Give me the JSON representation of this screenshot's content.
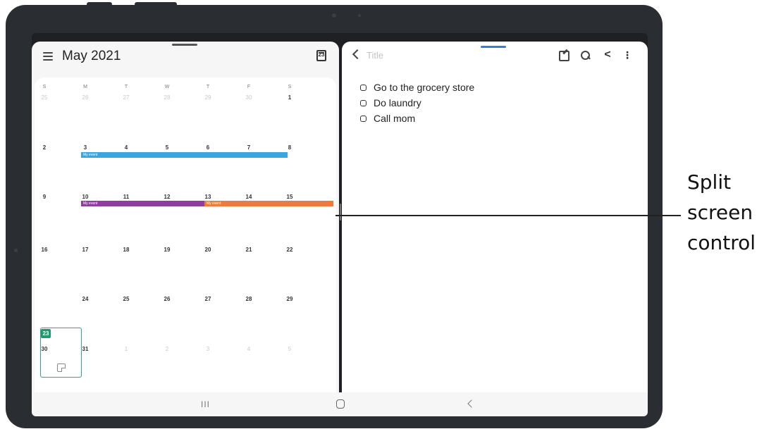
{
  "calendar": {
    "month_title": "May 2021",
    "today_icon_label": "23",
    "weekdays": [
      "S",
      "M",
      "T",
      "W",
      "T",
      "F",
      "S"
    ],
    "weeks": [
      [
        "25",
        "26",
        "27",
        "28",
        "29",
        "30",
        "1"
      ],
      [
        "2",
        "3",
        "4",
        "5",
        "6",
        "7",
        "8"
      ],
      [
        "9",
        "10",
        "11",
        "12",
        "13",
        "14",
        "15"
      ],
      [
        "16",
        "17",
        "18",
        "19",
        "20",
        "21",
        "22"
      ],
      [
        "23",
        "24",
        "25",
        "26",
        "27",
        "28",
        "29"
      ],
      [
        "30",
        "31",
        "1",
        "2",
        "3",
        "4",
        "5"
      ]
    ],
    "events": [
      {
        "label": "My event",
        "color": "#3aa6df"
      },
      {
        "label": "My event",
        "color": "#8e3f9e"
      },
      {
        "label": "My event",
        "color": "#ee7a3e"
      }
    ],
    "today": "23",
    "add_button_label": "+"
  },
  "notes": {
    "title_placeholder": "Title",
    "items": [
      {
        "text": "Go to the grocery store"
      },
      {
        "text": "Do laundry"
      },
      {
        "text": "Call mom"
      }
    ]
  },
  "navbar": {
    "recent_label": "III"
  },
  "callout": {
    "lines": [
      "Split",
      "screen",
      "control"
    ]
  },
  "colors": {
    "accent_green": "#1f9a6f",
    "accent_blue": "#3a7bd5",
    "tablet_body": "#2a2d31"
  }
}
